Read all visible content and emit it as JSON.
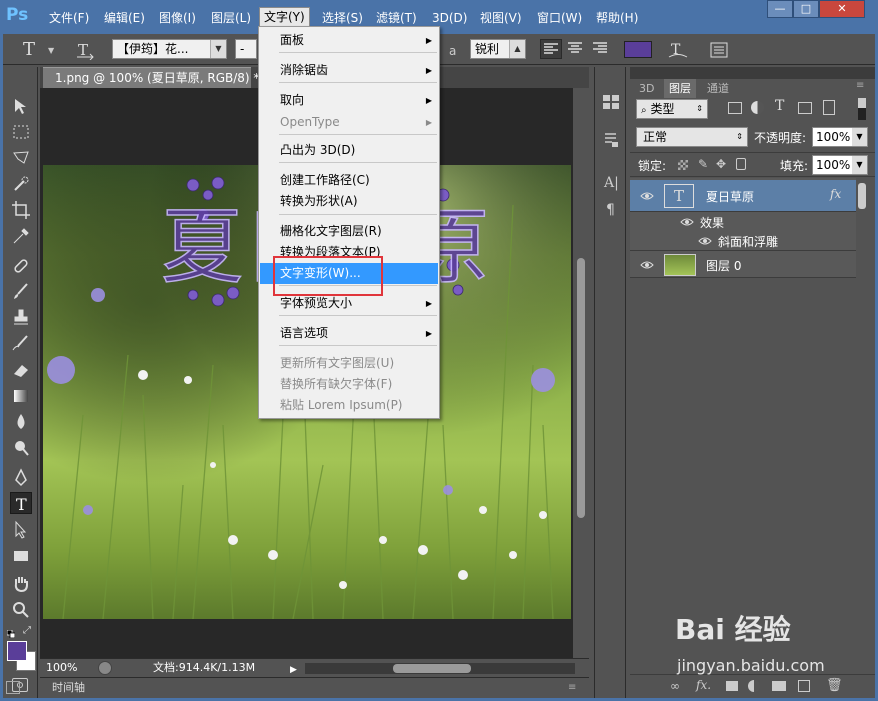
{
  "menubar": {
    "logo": "Ps",
    "items": [
      "文件(F)",
      "编辑(E)",
      "图像(I)",
      "图层(L)",
      "文字(Y)",
      "选择(S)",
      "滤镜(T)",
      "3D(D)",
      "视图(V)",
      "窗口(W)",
      "帮助(H)"
    ],
    "active_index": 4,
    "window_buttons": [
      "—",
      "□",
      "✕"
    ]
  },
  "options": {
    "font_family": "【伊筠】花...",
    "font_style": "-",
    "antialias": "锐利",
    "color": "#5a3e99"
  },
  "document": {
    "tab_title": "1.png @ 100% (夏日草原, RGB/8) *",
    "canvas_text": "夏日草原",
    "zoom": "100%",
    "doc_info": "文档:914.4K/1.13M"
  },
  "timeline": {
    "label": "时间轴"
  },
  "text_menu": {
    "items": [
      {
        "label": "面板",
        "submenu": true,
        "disabled": false
      },
      {
        "label": "消除锯齿",
        "submenu": true,
        "disabled": false
      },
      {
        "label": "取向",
        "submenu": true,
        "disabled": false
      },
      {
        "label": "OpenType",
        "submenu": true,
        "disabled": true
      },
      {
        "label": "凸出为 3D(D)",
        "submenu": false,
        "disabled": false
      },
      {
        "label": "创建工作路径(C)",
        "submenu": false,
        "disabled": false
      },
      {
        "label": "转换为形状(A)",
        "submenu": false,
        "disabled": false
      },
      {
        "label": "栅格化文字图层(R)",
        "submenu": false,
        "disabled": false
      },
      {
        "label": "转换为段落文本(P)",
        "submenu": false,
        "disabled": false
      },
      {
        "label": "文字变形(W)...",
        "submenu": false,
        "disabled": false,
        "highlighted": true
      },
      {
        "label": "字体预览大小",
        "submenu": true,
        "disabled": false
      },
      {
        "label": "语言选项",
        "submenu": true,
        "disabled": false
      },
      {
        "label": "更新所有文字图层(U)",
        "submenu": false,
        "disabled": true
      },
      {
        "label": "替换所有缺欠字体(F)",
        "submenu": false,
        "disabled": true
      },
      {
        "label": "粘贴 Lorem Ipsum(P)",
        "submenu": false,
        "disabled": true
      }
    ]
  },
  "layers_panel": {
    "tabs": [
      "3D",
      "图层",
      "通道"
    ],
    "active_tab": 1,
    "filter_kind": "类型",
    "blend_mode": "正常",
    "opacity_label": "不透明度:",
    "opacity_value": "100%",
    "lock_label": "锁定:",
    "fill_label": "填充:",
    "fill_value": "100%",
    "layers": [
      {
        "name": "夏日草原",
        "type": "text",
        "fx": "fx",
        "selected": true
      },
      {
        "name": "效果",
        "type": "effects-header"
      },
      {
        "name": "斜面和浮雕",
        "type": "effect"
      },
      {
        "name": "图层 0",
        "type": "image"
      }
    ]
  },
  "watermark": {
    "brand": "Bai 经验",
    "url": "jingyan.baidu.com"
  }
}
